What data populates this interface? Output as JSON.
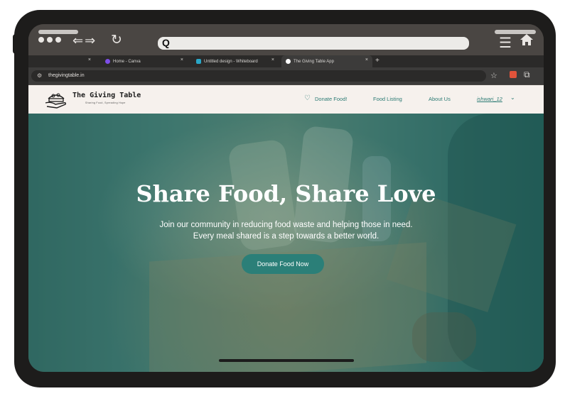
{
  "browser": {
    "tabs": [
      {
        "label": "",
        "close": "×"
      },
      {
        "label": "Home - Canva",
        "close": "×",
        "favicon_color": "#7d4ee8"
      },
      {
        "label": "Untitled design - Whiteboard",
        "close": "×",
        "favicon_color": "#2aa7c7"
      },
      {
        "label": "The Giving Table App",
        "close": "×",
        "favicon_color": "#ffffff",
        "active": true
      }
    ],
    "new_tab": "+",
    "url": "thegivingtable.in",
    "search_icon": "Q"
  },
  "site": {
    "brand": "The Giving Table",
    "tagline": "Sharing Food, Spreading Hope",
    "nav": {
      "donate": "Donate Food!",
      "listing": "Food Listing",
      "about": "About Us",
      "user": "ishwari_12"
    }
  },
  "hero": {
    "title": "Share Food, Share Love",
    "subtitle_line1": "Join our community in reducing food waste and helping those in need.",
    "subtitle_line2": "Every meal shared is a step towards a better world.",
    "cta": "Donate Food Now"
  },
  "colors": {
    "accent": "#2c7b74",
    "nav_bg": "#f6f1ed",
    "frame": "#1d1c1b"
  },
  "icons": [
    "search-icon",
    "reload-icon",
    "menu-icon",
    "home-icon",
    "star-icon",
    "heart-icon",
    "chevron-down-icon",
    "logo-icon"
  ]
}
